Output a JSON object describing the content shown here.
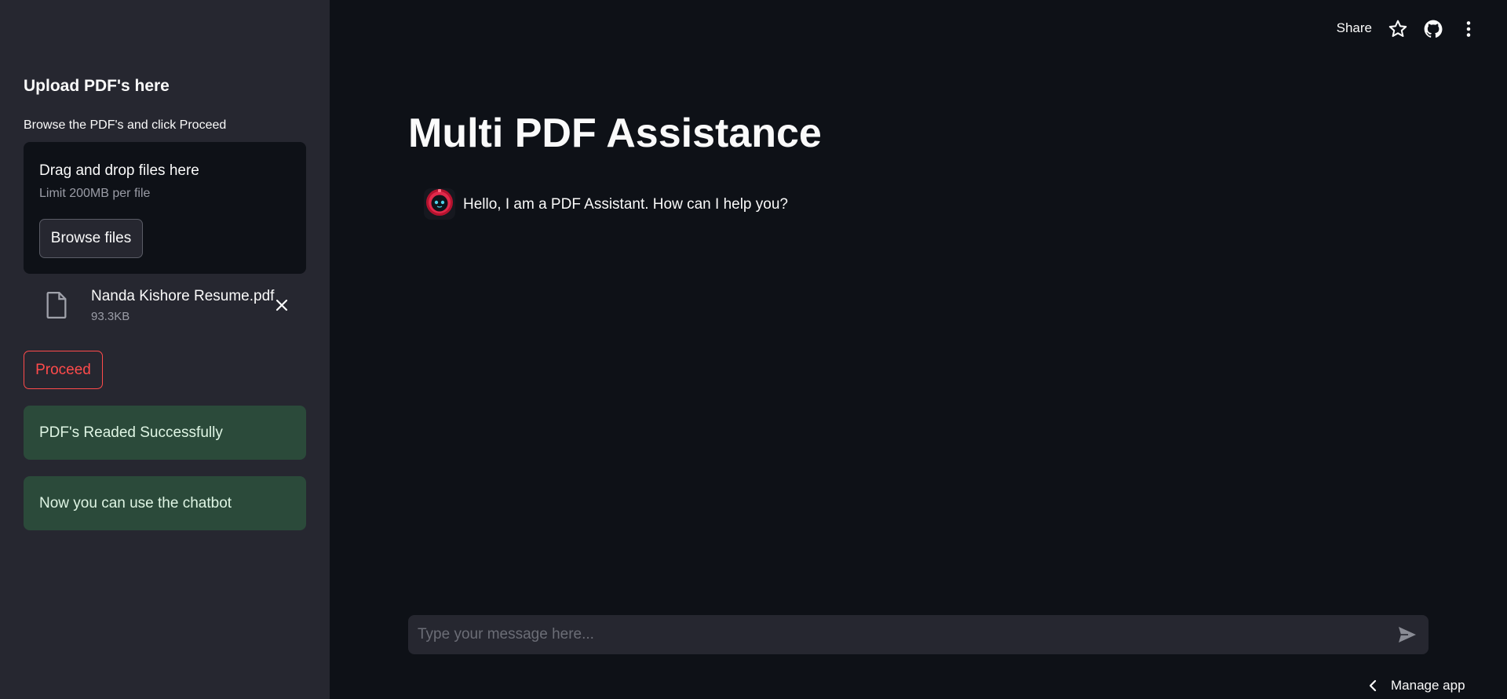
{
  "sidebar": {
    "title": "Upload PDF's here",
    "subtitle": "Browse the PDF's and click Proceed",
    "dropzone": {
      "title": "Drag and drop files here",
      "limit": "Limit 200MB per file",
      "browse_label": "Browse files"
    },
    "file": {
      "name": "Nanda Kishore Resume.pdf",
      "size": "93.3KB",
      "icon": "file-icon"
    },
    "proceed_label": "Proceed",
    "alerts": [
      "PDF's Readed Successfully",
      "Now you can use the chatbot"
    ]
  },
  "header": {
    "share_label": "Share",
    "icons": [
      "star-icon",
      "github-icon",
      "more-vertical-icon"
    ]
  },
  "main": {
    "title": "Multi PDF Assistance",
    "messages": [
      {
        "role": "assistant",
        "avatar": "robot-avatar",
        "text": "Hello, I am a PDF Assistant. How can I help you?"
      }
    ],
    "input": {
      "placeholder": "Type your message here...",
      "value": ""
    }
  },
  "footer": {
    "manage_label": "Manage app"
  },
  "colors": {
    "background": "#0e1117",
    "sidebar": "#262730",
    "accent": "#ff4b4b",
    "success_bg": "#2b4a3a"
  }
}
